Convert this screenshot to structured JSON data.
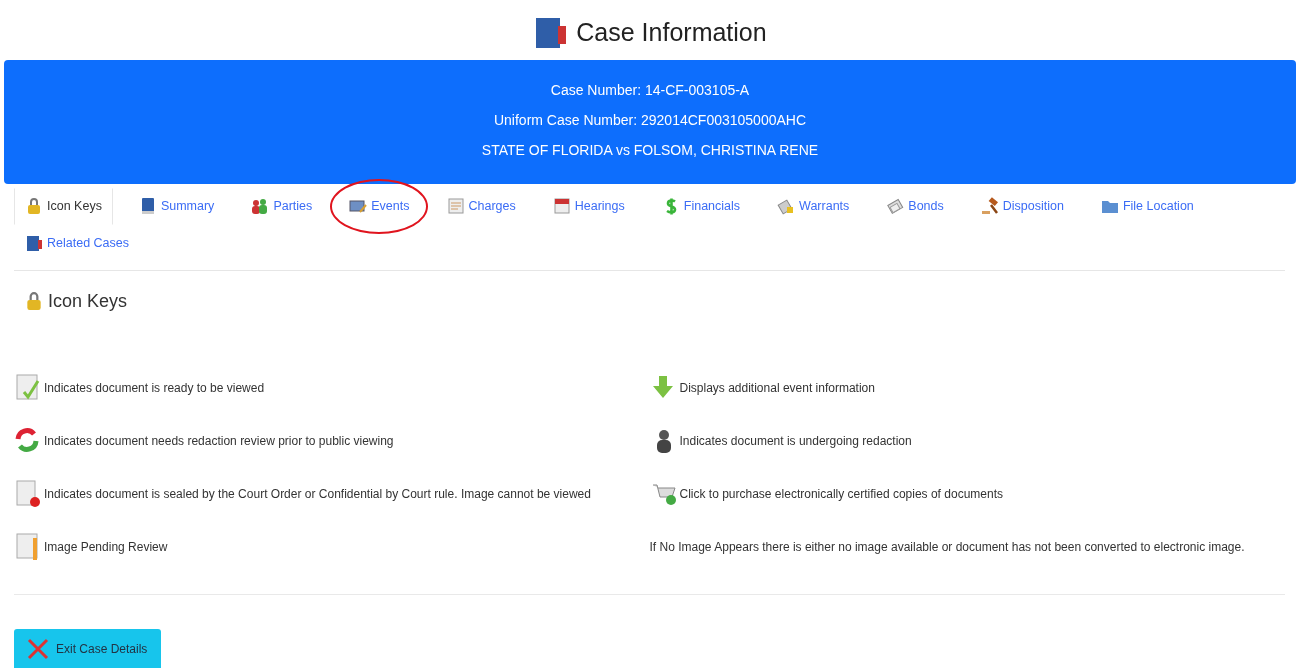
{
  "title": "Case Information",
  "banner": {
    "lines": [
      "Case Number: 14-CF-003105-A",
      "Uniform Case Number: 292014CF003105000AHC",
      "STATE OF FLORIDA vs FOLSOM, CHRISTINA RENE"
    ]
  },
  "tabs": [
    {
      "label": "Icon Keys",
      "selected": true,
      "highlighted": false
    },
    {
      "label": "Summary",
      "selected": false,
      "highlighted": false
    },
    {
      "label": "Parties",
      "selected": false,
      "highlighted": false
    },
    {
      "label": "Events",
      "selected": false,
      "highlighted": true
    },
    {
      "label": "Charges",
      "selected": false,
      "highlighted": false
    },
    {
      "label": "Hearings",
      "selected": false,
      "highlighted": false
    },
    {
      "label": "Financials",
      "selected": false,
      "highlighted": false
    },
    {
      "label": "Warrants",
      "selected": false,
      "highlighted": false
    },
    {
      "label": "Bonds",
      "selected": false,
      "highlighted": false
    },
    {
      "label": "Disposition",
      "selected": false,
      "highlighted": false
    },
    {
      "label": "File Location",
      "selected": false,
      "highlighted": false
    },
    {
      "label": "Related Cases",
      "selected": false,
      "highlighted": false
    }
  ],
  "section": {
    "heading": "Icon Keys"
  },
  "keys_left": [
    {
      "text": "Indicates document is ready to be viewed"
    },
    {
      "text": "Indicates document needs redaction review prior to public viewing"
    },
    {
      "text": "Indicates document is sealed by the Court Order or Confidential by Court rule. Image cannot be viewed"
    },
    {
      "text": "Image Pending Review"
    }
  ],
  "keys_right": [
    {
      "text": "Displays additional event information"
    },
    {
      "text": "Indicates document is undergoing redaction"
    },
    {
      "text": "Click to purchase electronically certified copies of documents"
    },
    {
      "text": "If No Image Appears there is either no image available or document has not been converted to electronic image."
    }
  ],
  "exit_button": {
    "label": "Exit Case Details"
  }
}
